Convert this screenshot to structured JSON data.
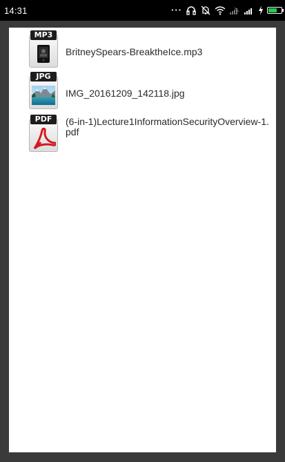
{
  "status_bar": {
    "time": "14:31",
    "icons": [
      "more-dots-icon",
      "headset-icon",
      "mute-icon",
      "wifi-icon",
      "signal-off-icon",
      "signal-icon",
      "charging-icon",
      "battery-icon"
    ],
    "battery_color": "#27c94a"
  },
  "files": [
    {
      "label": "MP3",
      "name": "BritneySpears-BreaktheIce.mp3",
      "icon": "mp3-file-icon",
      "label_color": "#1d1d1d"
    },
    {
      "label": "JPG",
      "name": "IMG_20161209_142118.jpg",
      "icon": "jpg-file-icon",
      "label_color": "#1d1d1d"
    },
    {
      "label": "PDF",
      "name": "(6-in-1)Lecture1InformationSecurityOverview-1.pdf",
      "icon": "pdf-file-icon",
      "label_color": "#1d1d1d"
    }
  ]
}
